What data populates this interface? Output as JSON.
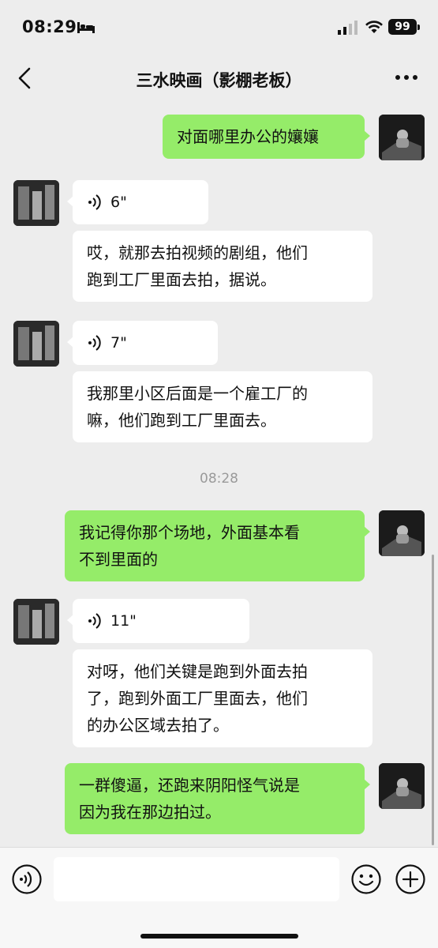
{
  "status_bar": {
    "time": "08:29",
    "battery": "99"
  },
  "header": {
    "title": "三水映画（影棚老板）"
  },
  "messages": [
    {
      "text": "对面哪里办公的孃孃"
    },
    {
      "duration": "6\""
    },
    {
      "text": "哎，就那去拍视频的剧组，他们"
    },
    {
      "text": "跑到工厂里面去拍，据说。"
    },
    {
      "duration": "7\""
    },
    {
      "text": "我那里小区后面是一个雇工厂的"
    },
    {
      "text": "嘛，他们跑到工厂里面去。"
    },
    {
      "text": "我记得你那个场地，外面基本看"
    },
    {
      "text": "不到里面的"
    },
    {
      "duration": "11\""
    },
    {
      "text": "对呀，他们关键是跑到外面去拍"
    },
    {
      "text": "了，跑到外面工厂里面去，他们"
    },
    {
      "text": "的办公区域去拍了。"
    },
    {
      "text": "一群傻逼，还跑来阴阳怪气说是"
    },
    {
      "text": "因为我在那边拍过。"
    }
  ],
  "timestamp": "08:28",
  "input_bar": {
    "placeholder": ""
  },
  "colors": {
    "outgoing": "#95ec69",
    "incoming": "#ffffff",
    "background": "#ededed"
  }
}
